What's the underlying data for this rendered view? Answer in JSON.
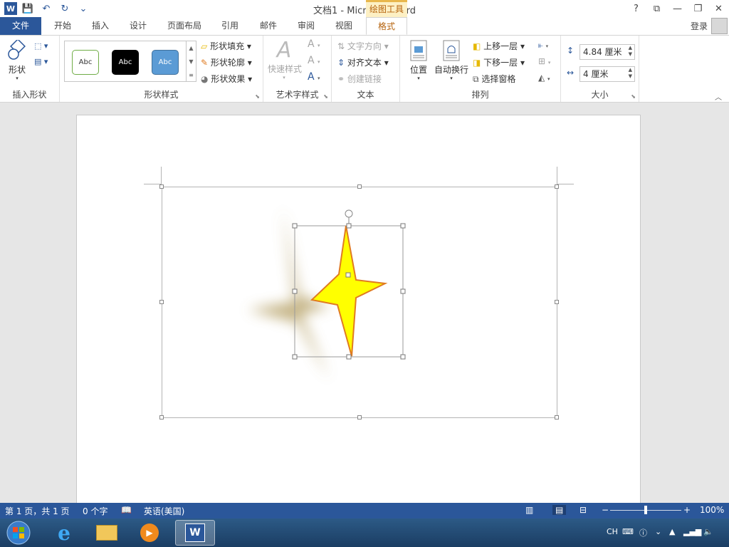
{
  "titlebar": {
    "title": "文档1 - Microsoft Word",
    "context_tab": "绘图工具",
    "help": "?",
    "ribbon_display": "⧉",
    "minimize": "—",
    "restore": "❐",
    "close": "✕"
  },
  "qat": {
    "save": "💾",
    "undo": "↶",
    "redo": "↻",
    "more": "⌄"
  },
  "tabs": {
    "file": "文件",
    "home": "开始",
    "insert": "插入",
    "design": "设计",
    "layout": "页面布局",
    "references": "引用",
    "mailings": "邮件",
    "review": "审阅",
    "view": "视图",
    "format": "格式",
    "login": "登录"
  },
  "ribbon": {
    "insert_shapes": {
      "label": "插入形状",
      "shapes": "形状"
    },
    "shape_styles": {
      "label": "形状样式",
      "style1": "Abc",
      "style2": "Abc",
      "style3": "Abc",
      "fill": "形状填充",
      "outline": "形状轮廓",
      "effects": "形状效果"
    },
    "wordart": {
      "label": "艺术字样式",
      "quick_styles": "快速样式"
    },
    "text": {
      "label": "文本",
      "direction": "文字方向",
      "align": "对齐文本",
      "link": "创建链接"
    },
    "arrange": {
      "label": "排列",
      "position": "位置",
      "wrap": "自动换行",
      "forward": "上移一层",
      "backward": "下移一层",
      "selection_pane": "选择窗格"
    },
    "size": {
      "label": "大小",
      "height": "4.84 厘米",
      "width": "4 厘米"
    }
  },
  "statusbar": {
    "page": "第 1 页，共 1 页",
    "words": "0 个字",
    "language": "英语(美国)",
    "zoom": "100%",
    "zoom_level": 1.0
  },
  "taskbar": {
    "ime": "CH"
  },
  "colors": {
    "brand": "#2b579a",
    "context_accent": "#b5620c",
    "star_fill": "#ffff00",
    "star_outline": "#e07b21",
    "shadow": "#b29c5e"
  }
}
